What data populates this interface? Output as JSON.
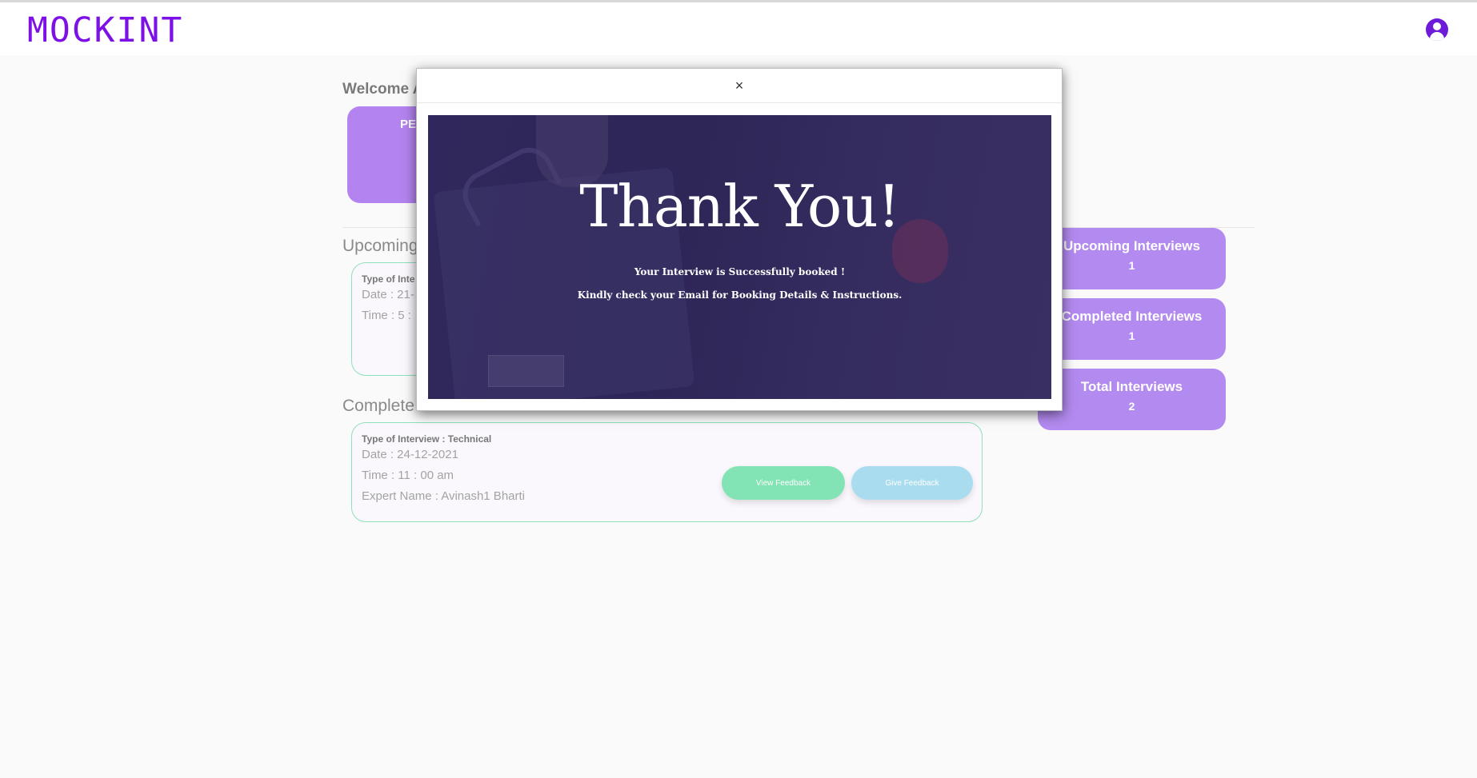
{
  "app": {
    "logo": "MOCKINT"
  },
  "dashboard": {
    "welcome": "Welcome A",
    "pending_card_label": "PE",
    "upcoming_heading": "Upcoming",
    "completed_heading": "Complete",
    "upcoming_card": {
      "type": "Type of Inte",
      "date": "Date : 21-",
      "time": "Time : 5 :"
    },
    "completed_card": {
      "type": "Type of Interview : Technical",
      "date": "Date : 24-12-2021",
      "time": "Time : 11 : 00 am",
      "expert": "Expert Name : Avinash1 Bharti",
      "view_feedback": "View Feedback",
      "give_feedback": "Give Feedback"
    },
    "stats": [
      {
        "label": "Upcoming Interviews",
        "value": "1"
      },
      {
        "label": "Completed Interviews",
        "value": "1"
      },
      {
        "label": "Total Interviews",
        "value": "2"
      }
    ]
  },
  "modal": {
    "close": "×",
    "title": "Thank You!",
    "line1": "Your Interview is Successfully booked !",
    "line2": "Kindly check your Email for Booking Details & Instructions."
  },
  "icons": {
    "profile": "user-circle-icon",
    "close": "close-icon"
  },
  "colors": {
    "brand": "#7c10e6",
    "stat_card": "#b38aef",
    "view_button": "#82e3b5",
    "give_button": "#a9dcef",
    "card_border": "#8fe0bb",
    "banner": "#2d2455"
  }
}
